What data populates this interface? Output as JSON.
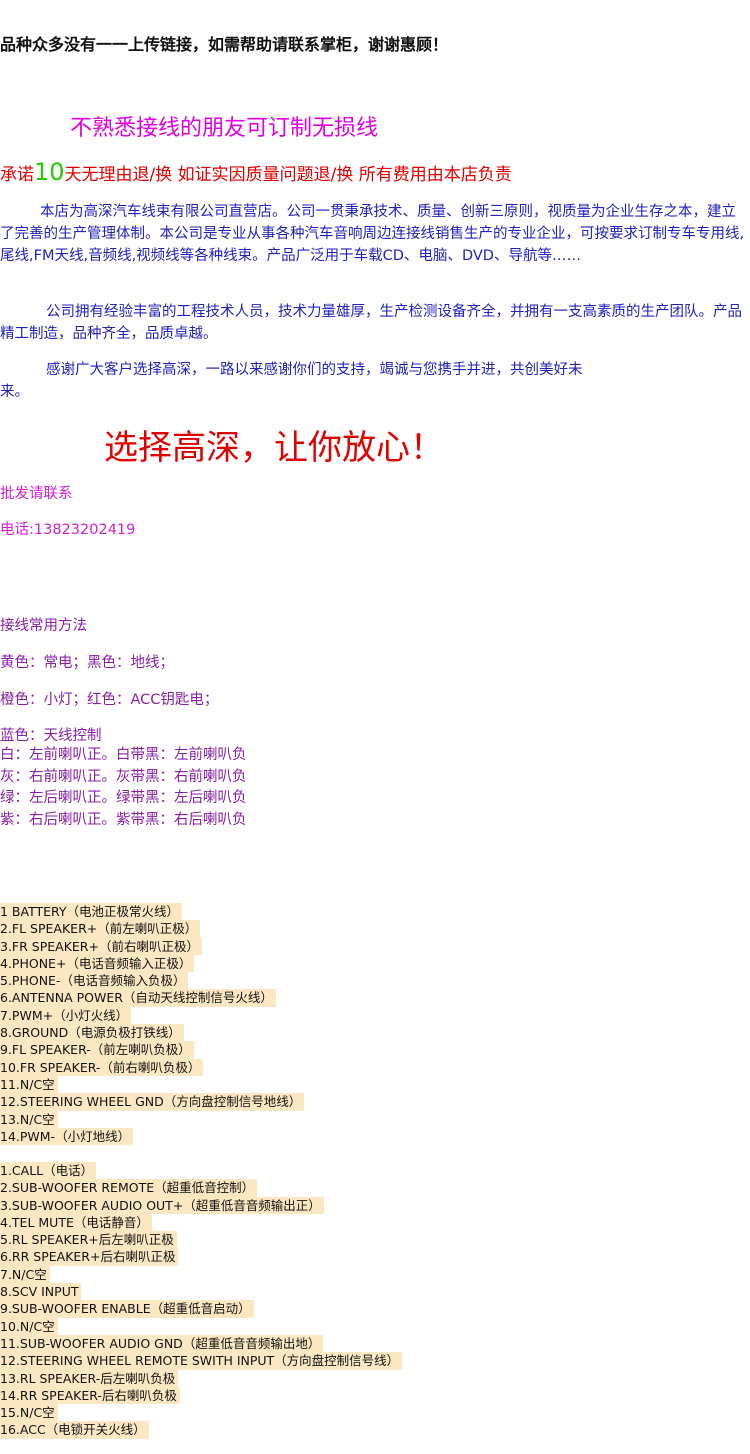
{
  "headline": "品种众多没有一一上传链接，如需帮助请联系掌柜，谢谢惠顾！",
  "custom_cable": "不熟悉接线的朋友可订制无损线",
  "promise": {
    "prefix": "承诺",
    "days": "10",
    "suffix": "天无理由退/换 如证实因质量问题退/换 所有费用由本店负责"
  },
  "intro": "本店为高深汽车线束有限公司直营店。公司一贯秉承技术、质量、创新三原则，视质量为企业生存之本，建立了完善的生产管理体制。本公司是专业从事各种汽车音响周边连接线销售生产的专业企业，可按要求订制专车专用线,尾线,FM天线,音频线,视频线等各种线束。产品广泛用于车载CD、电脑、DVD、导航等……",
  "engineers": "公司拥有经验丰富的工程技术人员，技术力量雄厚，生产检测设备齐全，并拥有一支高素质的生产团队。产品精工制造，品种齐全，品质卓越。",
  "thanks": {
    "line1": "感谢广大客户选择高深，一路以来感谢你们的支持，竭诚与您携手并进，共创美好未",
    "line2": "来。"
  },
  "slogan": "选择高深，让你放心！",
  "wholesale": "批发请联系",
  "phone": "电话:13823202419",
  "method_title": "接线常用方法",
  "color_lines": [
    "黄色：常电；黑色：地线；",
    "橙色：小灯；红色：ACC钥匙电；",
    "蓝色：天线控制"
  ],
  "speaker_lines": [
    "白：左前喇叭正。白带黑：左前喇叭负",
    "灰：右前喇叭正。灰带黑：右前喇叭负",
    "绿：左后喇叭正。绿带黑：左后喇叭负",
    "紫：右后喇叭正。紫带黑：右后喇叭负"
  ],
  "pins_a": [
    "1 BATTERY（电池正极常火线）",
    "2.FL SPEAKER+（前左喇叭正极）",
    "3.FR SPEAKER+（前右喇叭正极）",
    "4.PHONE+（电话音频输入正极）",
    "5.PHONE-（电话音频输入负极）",
    "6.ANTENNA POWER（自动天线控制信号火线）",
    "7.PWM+（小灯火线）",
    "8.GROUND（电源负极打铁线）",
    "9.FL SPEAKER-（前左喇叭负极）",
    "10.FR SPEAKER-（前右喇叭负极）",
    "11.N/C空",
    "12.STEERING WHEEL GND（方向盘控制信号地线）",
    "13.N/C空",
    "14.PWM-（小灯地线）"
  ],
  "pins_b": [
    "1.CALL（电话）",
    "2.SUB-WOOFER REMOTE（超重低音控制）",
    "3.SUB-WOOFER AUDIO OUT+（超重低音音频输出正）",
    "4.TEL MUTE（电话静音）",
    "5.RL SPEAKER+后左喇叭正极",
    "6.RR SPEAKER+后右喇叭正极",
    "7.N/C空",
    "8.SCV INPUT",
    "9.SUB-WOOFER ENABLE（超重低音启动）",
    "10.N/C空",
    "11.SUB-WOOFER AUDIO GND（超重低音音频输出地）",
    "12.STEERING WHEEL REMOTE SWITH INPUT（方向盘控制信号线）",
    "13.RL SPEAKER-后左喇叭负极",
    "14.RR SPEAKER-后右喇叭负极",
    "15.N/C空",
    "16.ACC（电锁开关火线）"
  ],
  "colors": {
    "headline": "#111111",
    "magenta": "#e000e0",
    "red": "#e00000",
    "green": "#22cc00",
    "blue": "#2222bb",
    "purple": "#8820a8",
    "pin_highlight": "#fbe7c2"
  }
}
